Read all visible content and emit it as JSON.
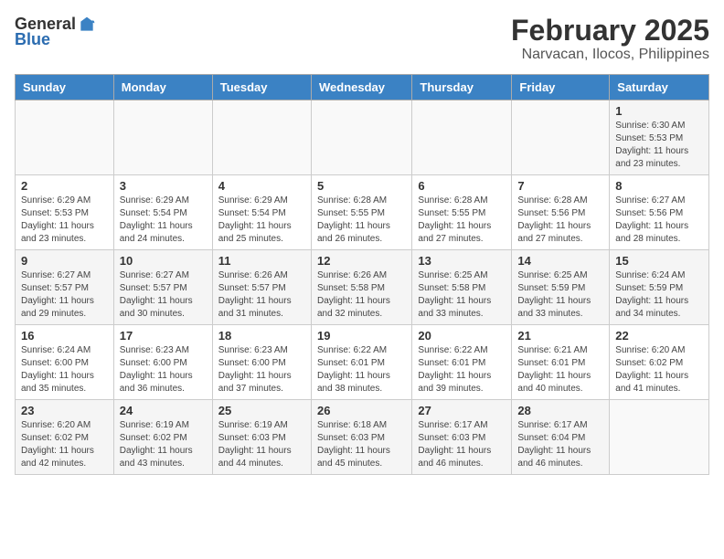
{
  "header": {
    "logo_general": "General",
    "logo_blue": "Blue",
    "month_title": "February 2025",
    "location": "Narvacan, Ilocos, Philippines"
  },
  "weekdays": [
    "Sunday",
    "Monday",
    "Tuesday",
    "Wednesday",
    "Thursday",
    "Friday",
    "Saturday"
  ],
  "weeks": [
    [
      {
        "day": "",
        "info": ""
      },
      {
        "day": "",
        "info": ""
      },
      {
        "day": "",
        "info": ""
      },
      {
        "day": "",
        "info": ""
      },
      {
        "day": "",
        "info": ""
      },
      {
        "day": "",
        "info": ""
      },
      {
        "day": "1",
        "info": "Sunrise: 6:30 AM\nSunset: 5:53 PM\nDaylight: 11 hours and 23 minutes."
      }
    ],
    [
      {
        "day": "2",
        "info": "Sunrise: 6:29 AM\nSunset: 5:53 PM\nDaylight: 11 hours and 23 minutes."
      },
      {
        "day": "3",
        "info": "Sunrise: 6:29 AM\nSunset: 5:54 PM\nDaylight: 11 hours and 24 minutes."
      },
      {
        "day": "4",
        "info": "Sunrise: 6:29 AM\nSunset: 5:54 PM\nDaylight: 11 hours and 25 minutes."
      },
      {
        "day": "5",
        "info": "Sunrise: 6:28 AM\nSunset: 5:55 PM\nDaylight: 11 hours and 26 minutes."
      },
      {
        "day": "6",
        "info": "Sunrise: 6:28 AM\nSunset: 5:55 PM\nDaylight: 11 hours and 27 minutes."
      },
      {
        "day": "7",
        "info": "Sunrise: 6:28 AM\nSunset: 5:56 PM\nDaylight: 11 hours and 27 minutes."
      },
      {
        "day": "8",
        "info": "Sunrise: 6:27 AM\nSunset: 5:56 PM\nDaylight: 11 hours and 28 minutes."
      }
    ],
    [
      {
        "day": "9",
        "info": "Sunrise: 6:27 AM\nSunset: 5:57 PM\nDaylight: 11 hours and 29 minutes."
      },
      {
        "day": "10",
        "info": "Sunrise: 6:27 AM\nSunset: 5:57 PM\nDaylight: 11 hours and 30 minutes."
      },
      {
        "day": "11",
        "info": "Sunrise: 6:26 AM\nSunset: 5:57 PM\nDaylight: 11 hours and 31 minutes."
      },
      {
        "day": "12",
        "info": "Sunrise: 6:26 AM\nSunset: 5:58 PM\nDaylight: 11 hours and 32 minutes."
      },
      {
        "day": "13",
        "info": "Sunrise: 6:25 AM\nSunset: 5:58 PM\nDaylight: 11 hours and 33 minutes."
      },
      {
        "day": "14",
        "info": "Sunrise: 6:25 AM\nSunset: 5:59 PM\nDaylight: 11 hours and 33 minutes."
      },
      {
        "day": "15",
        "info": "Sunrise: 6:24 AM\nSunset: 5:59 PM\nDaylight: 11 hours and 34 minutes."
      }
    ],
    [
      {
        "day": "16",
        "info": "Sunrise: 6:24 AM\nSunset: 6:00 PM\nDaylight: 11 hours and 35 minutes."
      },
      {
        "day": "17",
        "info": "Sunrise: 6:23 AM\nSunset: 6:00 PM\nDaylight: 11 hours and 36 minutes."
      },
      {
        "day": "18",
        "info": "Sunrise: 6:23 AM\nSunset: 6:00 PM\nDaylight: 11 hours and 37 minutes."
      },
      {
        "day": "19",
        "info": "Sunrise: 6:22 AM\nSunset: 6:01 PM\nDaylight: 11 hours and 38 minutes."
      },
      {
        "day": "20",
        "info": "Sunrise: 6:22 AM\nSunset: 6:01 PM\nDaylight: 11 hours and 39 minutes."
      },
      {
        "day": "21",
        "info": "Sunrise: 6:21 AM\nSunset: 6:01 PM\nDaylight: 11 hours and 40 minutes."
      },
      {
        "day": "22",
        "info": "Sunrise: 6:20 AM\nSunset: 6:02 PM\nDaylight: 11 hours and 41 minutes."
      }
    ],
    [
      {
        "day": "23",
        "info": "Sunrise: 6:20 AM\nSunset: 6:02 PM\nDaylight: 11 hours and 42 minutes."
      },
      {
        "day": "24",
        "info": "Sunrise: 6:19 AM\nSunset: 6:02 PM\nDaylight: 11 hours and 43 minutes."
      },
      {
        "day": "25",
        "info": "Sunrise: 6:19 AM\nSunset: 6:03 PM\nDaylight: 11 hours and 44 minutes."
      },
      {
        "day": "26",
        "info": "Sunrise: 6:18 AM\nSunset: 6:03 PM\nDaylight: 11 hours and 45 minutes."
      },
      {
        "day": "27",
        "info": "Sunrise: 6:17 AM\nSunset: 6:03 PM\nDaylight: 11 hours and 46 minutes."
      },
      {
        "day": "28",
        "info": "Sunrise: 6:17 AM\nSunset: 6:04 PM\nDaylight: 11 hours and 46 minutes."
      },
      {
        "day": "",
        "info": ""
      }
    ]
  ]
}
